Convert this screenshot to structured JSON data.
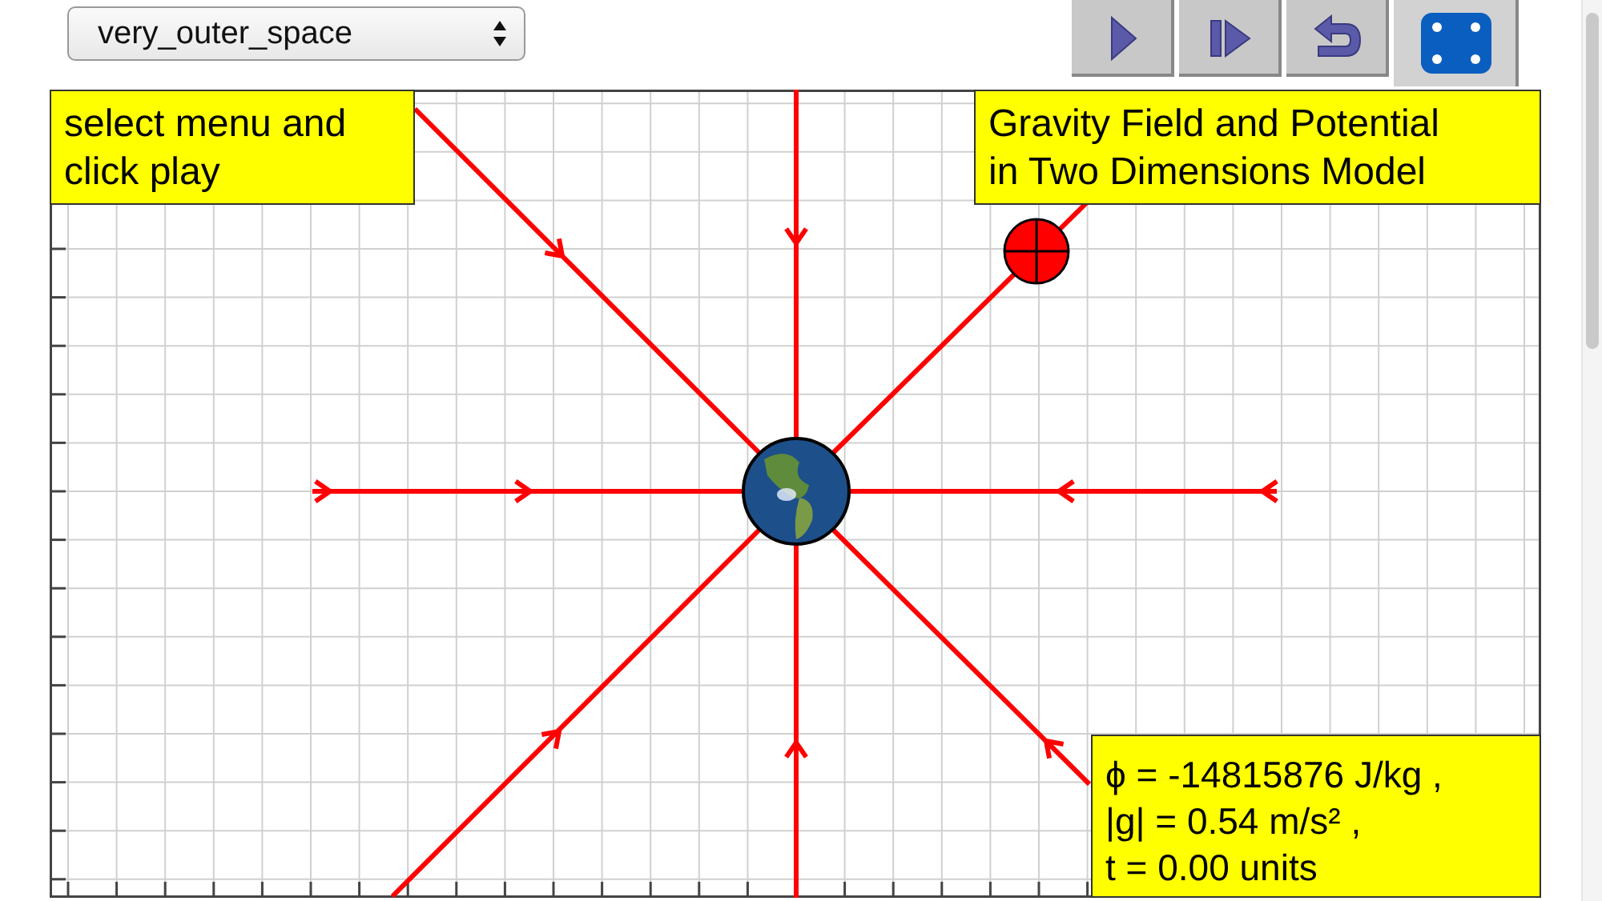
{
  "model_select": {
    "value": "very_outer_space"
  },
  "hint": [
    "select menu and",
    "click play"
  ],
  "title": [
    "Gravity Field and Potential",
    "in Two Dimensions Model"
  ],
  "readout": [
    "ϕ = -14815876 J/kg ,",
    "|g| = 0.54 m/s² ,",
    "t = 0.00 units"
  ]
}
